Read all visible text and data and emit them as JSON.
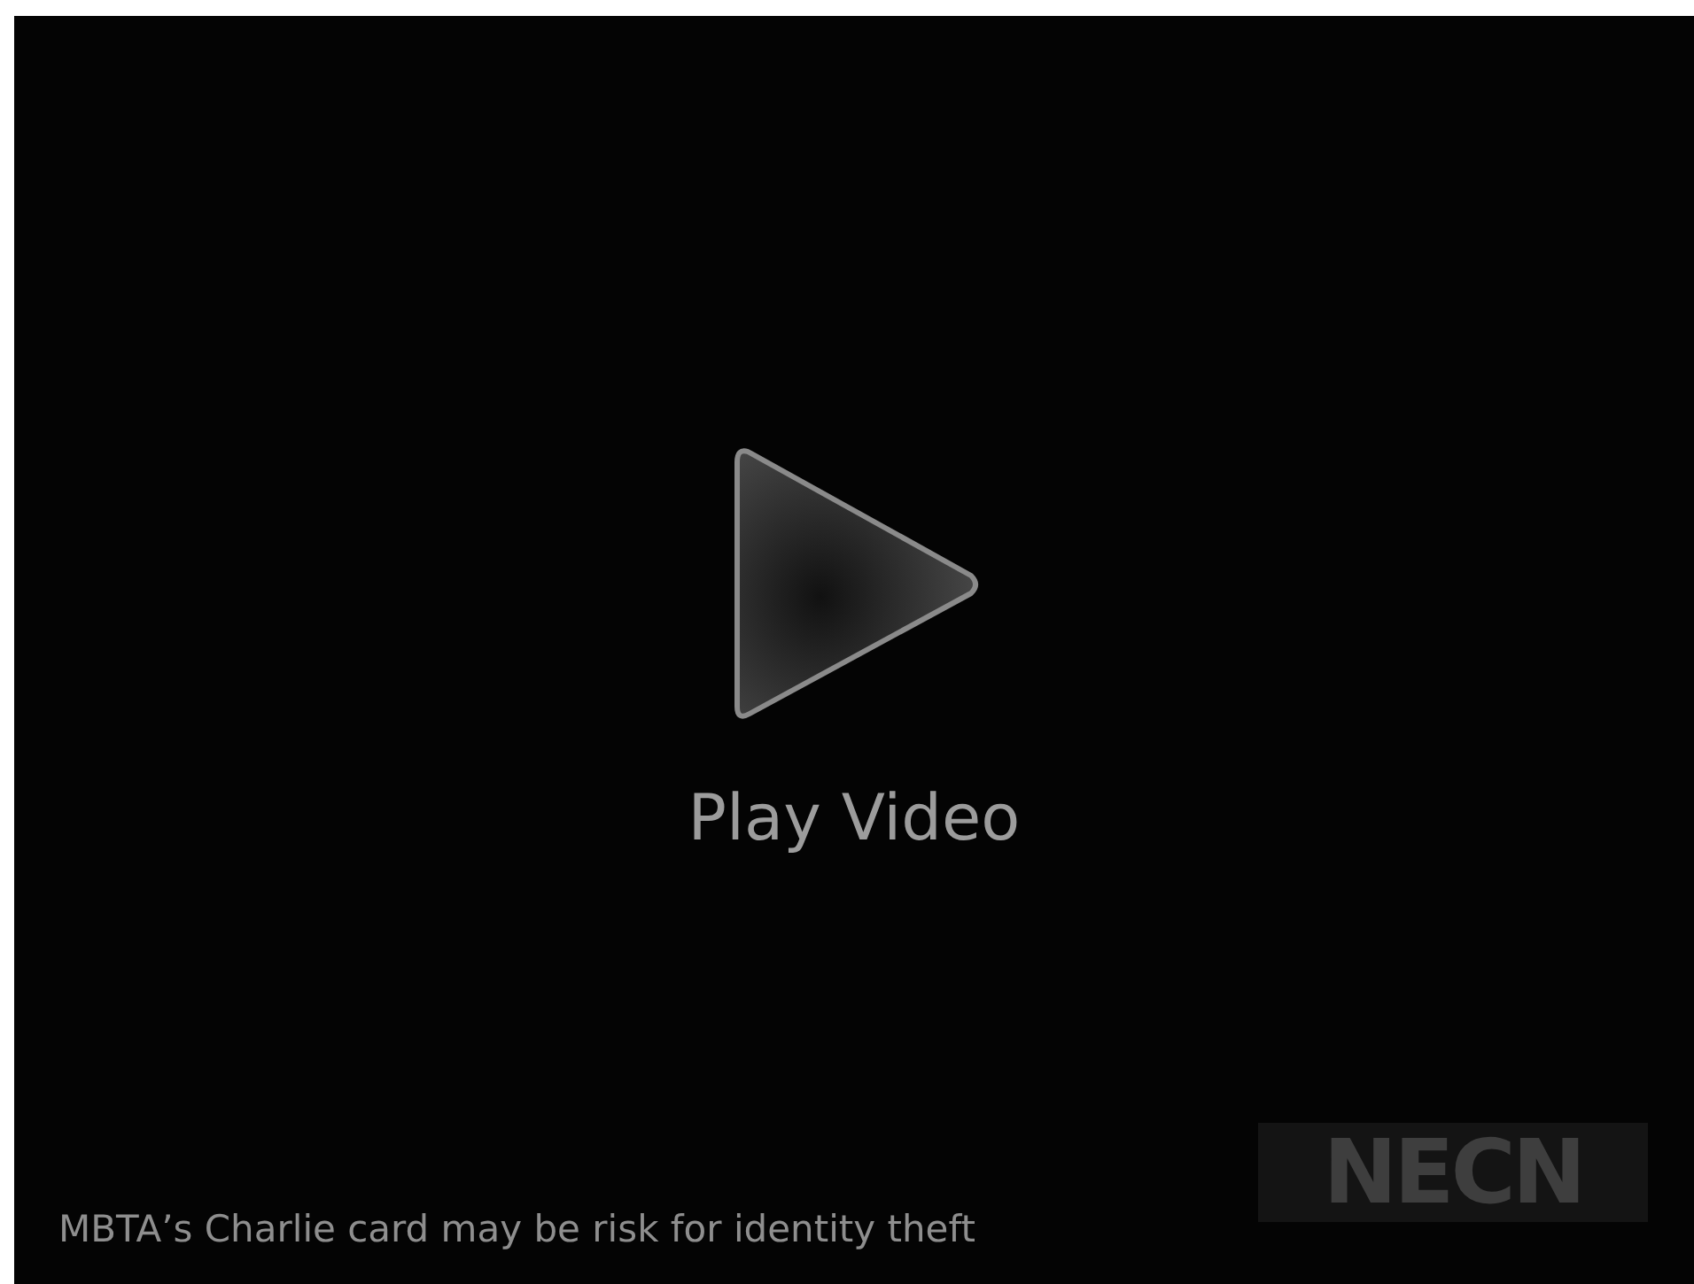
{
  "player": {
    "play_label": "Play Video",
    "caption": "MBTA’s Charlie card may be risk for identity theft",
    "logo": "NECN"
  }
}
